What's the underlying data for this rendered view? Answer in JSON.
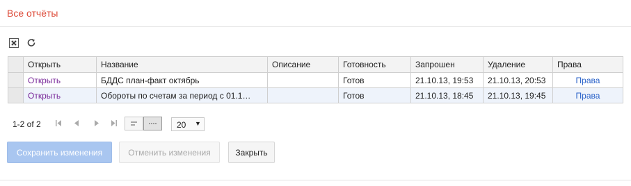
{
  "header": {
    "title": "Все отчёты"
  },
  "toolbar": {
    "icons": [
      "clear-filter-icon",
      "refresh-icon"
    ]
  },
  "table": {
    "columns": [
      "Открыть",
      "Название",
      "Описание",
      "Готовность",
      "Запрошен",
      "Удаление",
      "Права"
    ],
    "rows": [
      {
        "open": "Открыть",
        "name": "БДДС план-факт октябрь",
        "description": "",
        "status": "Готов",
        "requested": "21.10.13, 19:53",
        "deletion": "21.10.13, 20:53",
        "rights": "Права"
      },
      {
        "open": "Открыть",
        "name": "Обороты по счетам за период с 01.1…",
        "description": "",
        "status": "Готов",
        "requested": "21.10.13, 18:45",
        "deletion": "21.10.13, 19:45",
        "rights": "Права"
      }
    ]
  },
  "pager": {
    "count": "1-2 of 2",
    "page_size": "20"
  },
  "buttons": {
    "save": "Сохранить изменения",
    "cancel": "Отменить изменения",
    "close": "Закрыть"
  },
  "colors": {
    "title": "#dd4b39",
    "open_link": "#7a2a9a",
    "rights_link": "#2a62c9",
    "save_bg": "#a9c6f0",
    "alt_row": "#eef3fb"
  }
}
